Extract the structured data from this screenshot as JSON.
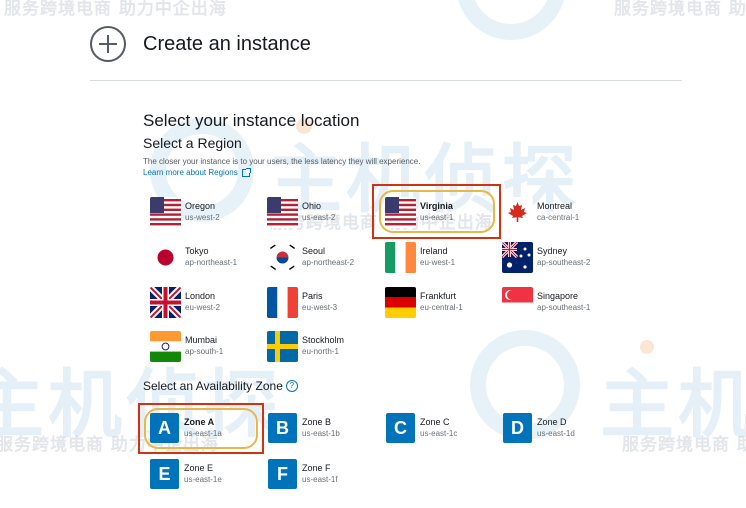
{
  "header": {
    "title": "Create an instance"
  },
  "location": {
    "heading": "Select your instance location",
    "region_heading": "Select a Region",
    "description": "The closer your instance is to your users, the less latency they will experience.",
    "learn_more": "Learn more about Regions"
  },
  "regions": [
    {
      "name": "Oregon",
      "code": "us-west-2",
      "flag": "us-flag-icon"
    },
    {
      "name": "Ohio",
      "code": "us-east-2",
      "flag": "us-flag-icon"
    },
    {
      "name": "Virginia",
      "code": "us-east-1",
      "flag": "us-flag-icon",
      "selected": true
    },
    {
      "name": "Montreal",
      "code": "ca-central-1",
      "flag": "maple-leaf-icon"
    },
    {
      "name": "Tokyo",
      "code": "ap-northeast-1",
      "flag": "japan-flag-icon"
    },
    {
      "name": "Seoul",
      "code": "ap-northeast-2",
      "flag": "korea-flag-icon"
    },
    {
      "name": "Ireland",
      "code": "eu-west-1",
      "flag": "ireland-flag-icon"
    },
    {
      "name": "Sydney",
      "code": "ap-southeast-2",
      "flag": "australia-flag-icon"
    },
    {
      "name": "London",
      "code": "eu-west-2",
      "flag": "uk-flag-icon"
    },
    {
      "name": "Paris",
      "code": "eu-west-3",
      "flag": "france-flag-icon"
    },
    {
      "name": "Frankfurt",
      "code": "eu-central-1",
      "flag": "germany-flag-icon"
    },
    {
      "name": "Singapore",
      "code": "ap-southeast-1",
      "flag": "singapore-flag-icon"
    },
    {
      "name": "Mumbai",
      "code": "ap-south-1",
      "flag": "india-flag-icon"
    },
    {
      "name": "Stockholm",
      "code": "eu-north-1",
      "flag": "sweden-flag-icon"
    }
  ],
  "availability": {
    "heading": "Select an Availability Zone",
    "info_icon": "?",
    "zones": [
      {
        "letter": "A",
        "name": "Zone A",
        "code": "us-east-1a",
        "selected": true
      },
      {
        "letter": "B",
        "name": "Zone B",
        "code": "us-east-1b"
      },
      {
        "letter": "C",
        "name": "Zone C",
        "code": "us-east-1c"
      },
      {
        "letter": "D",
        "name": "Zone D",
        "code": "us-east-1d"
      },
      {
        "letter": "E",
        "name": "Zone E",
        "code": "us-east-1e"
      },
      {
        "letter": "F",
        "name": "Zone F",
        "code": "us-east-1f"
      }
    ]
  },
  "watermark": {
    "text": "服务跨境电商 助力中企出海",
    "brand": "主机侦探"
  },
  "colors": {
    "accent": "#0073bb",
    "selection_border": "#d13212",
    "highlight_oval": "#e8b84a"
  }
}
